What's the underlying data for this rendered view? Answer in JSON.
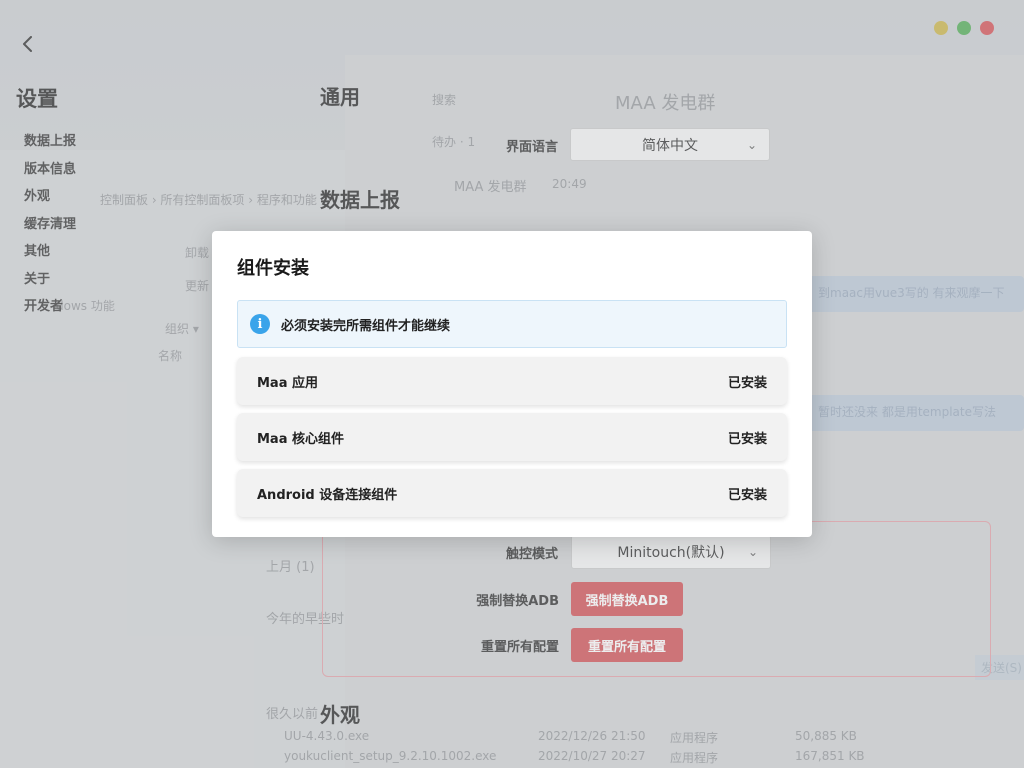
{
  "window": {
    "controls": [
      {
        "name": "minimize",
        "color": "#c9b13c"
      },
      {
        "name": "maximize",
        "color": "#46a84a"
      },
      {
        "name": "close",
        "color": "#d5464b"
      }
    ]
  },
  "sidebar": {
    "title": "设置",
    "items": [
      {
        "label": "数据上报"
      },
      {
        "label": "版本信息"
      },
      {
        "label": "外观"
      },
      {
        "label": "缓存清理"
      },
      {
        "label": "其他"
      },
      {
        "label": "关于"
      },
      {
        "label": "开发者"
      }
    ]
  },
  "content": {
    "general_heading": "通用",
    "language_label": "界面语言",
    "language_value": "简体中文",
    "data_report_heading": "数据上报",
    "touch_mode_label": "触控模式",
    "touch_mode_value": "Minitouch(默认)",
    "force_adb_label": "强制替换ADB",
    "force_adb_button": "强制替换ADB",
    "reset_label": "重置所有配置",
    "reset_button": "重置所有配置",
    "appearance_heading": "外观"
  },
  "modal": {
    "title": "组件安装",
    "info": "必须安装完所需组件才能继续",
    "components": [
      {
        "name": "Maa 应用",
        "status": "已安装"
      },
      {
        "name": "Maa 核心组件",
        "status": "已安装"
      },
      {
        "name": "Android 设备连接组件",
        "status": "已安装"
      }
    ]
  },
  "background": {
    "chat_title": "MAA 发电群",
    "search_placeholder": "搜索",
    "todo": "待办 · 1",
    "chat_item": "MAA 发电群",
    "chat_item_time": "20:49",
    "breadcrumb": "控制面板  ›  所有控制面板项  ›  程序和功能",
    "msg1": "到maac用vue3写的 有来观摩一下",
    "msg2": "暂时还没来 都是用template写法",
    "uninstall": "卸载",
    "update": "更新",
    "windows_features": "dows 功能",
    "org": "组织 ▾",
    "col_name": "名称",
    "uu_file": "UU-4.43.0.exe",
    "uu_date": "2022/12/26 21:50",
    "uu_type": "应用程序",
    "uu_size": "50,885 KB",
    "youku_file": "youkuclient_setup_9.2.10.1002.exe",
    "youku_date": "2022/10/27 20:27",
    "youku_type": "应用程序",
    "youku_size": "167,851 KB",
    "last_month": "上月 (1)",
    "this_year": "今年的早些时",
    "long_ago": "很久以前",
    "send": "发送(S)"
  }
}
